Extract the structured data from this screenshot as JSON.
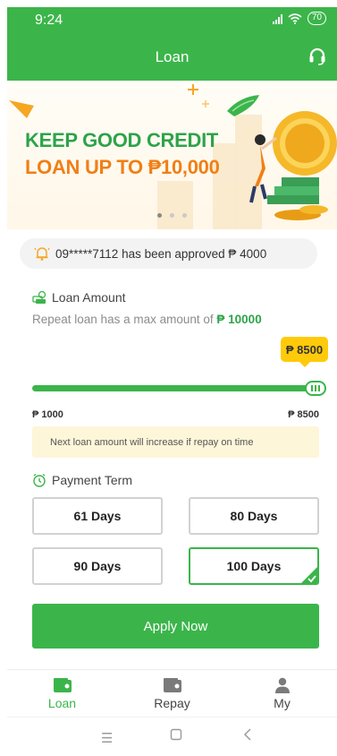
{
  "status": {
    "time": "9:24",
    "battery": "70"
  },
  "header": {
    "title": "Loan"
  },
  "banner": {
    "line1": "KEEP GOOD CREDIT",
    "line2": "LOAN UP TO ₱10,000",
    "coin_symbol": "$"
  },
  "notice": {
    "text": "09*****7112 has been approved ₱ 4000"
  },
  "loan_amount": {
    "title": "Loan Amount",
    "subtitle_prefix": "Repeat loan has a max amount of",
    "subtitle_value": "₱ 10000",
    "selected_label": "₱ 8500",
    "min_label": "₱ 1000",
    "max_label": "₱ 8500",
    "tip": "Next loan amount will increase if repay on time",
    "slider_fraction": 1.0
  },
  "payment_term": {
    "title": "Payment Term",
    "options": [
      {
        "label": "61 Days",
        "selected": false
      },
      {
        "label": "80 Days",
        "selected": false
      },
      {
        "label": "90 Days",
        "selected": false
      },
      {
        "label": "100 Days",
        "selected": true
      }
    ]
  },
  "apply_button": "Apply Now",
  "tabs": [
    {
      "label": "Loan",
      "icon": "wallet-icon",
      "active": true
    },
    {
      "label": "Repay",
      "icon": "wallet-icon",
      "active": false
    },
    {
      "label": "My",
      "icon": "person-icon",
      "active": false
    }
  ],
  "colors": {
    "primary": "#3bb54a",
    "accent_yellow": "#ffca0a",
    "banner_orange": "#f07f16"
  }
}
